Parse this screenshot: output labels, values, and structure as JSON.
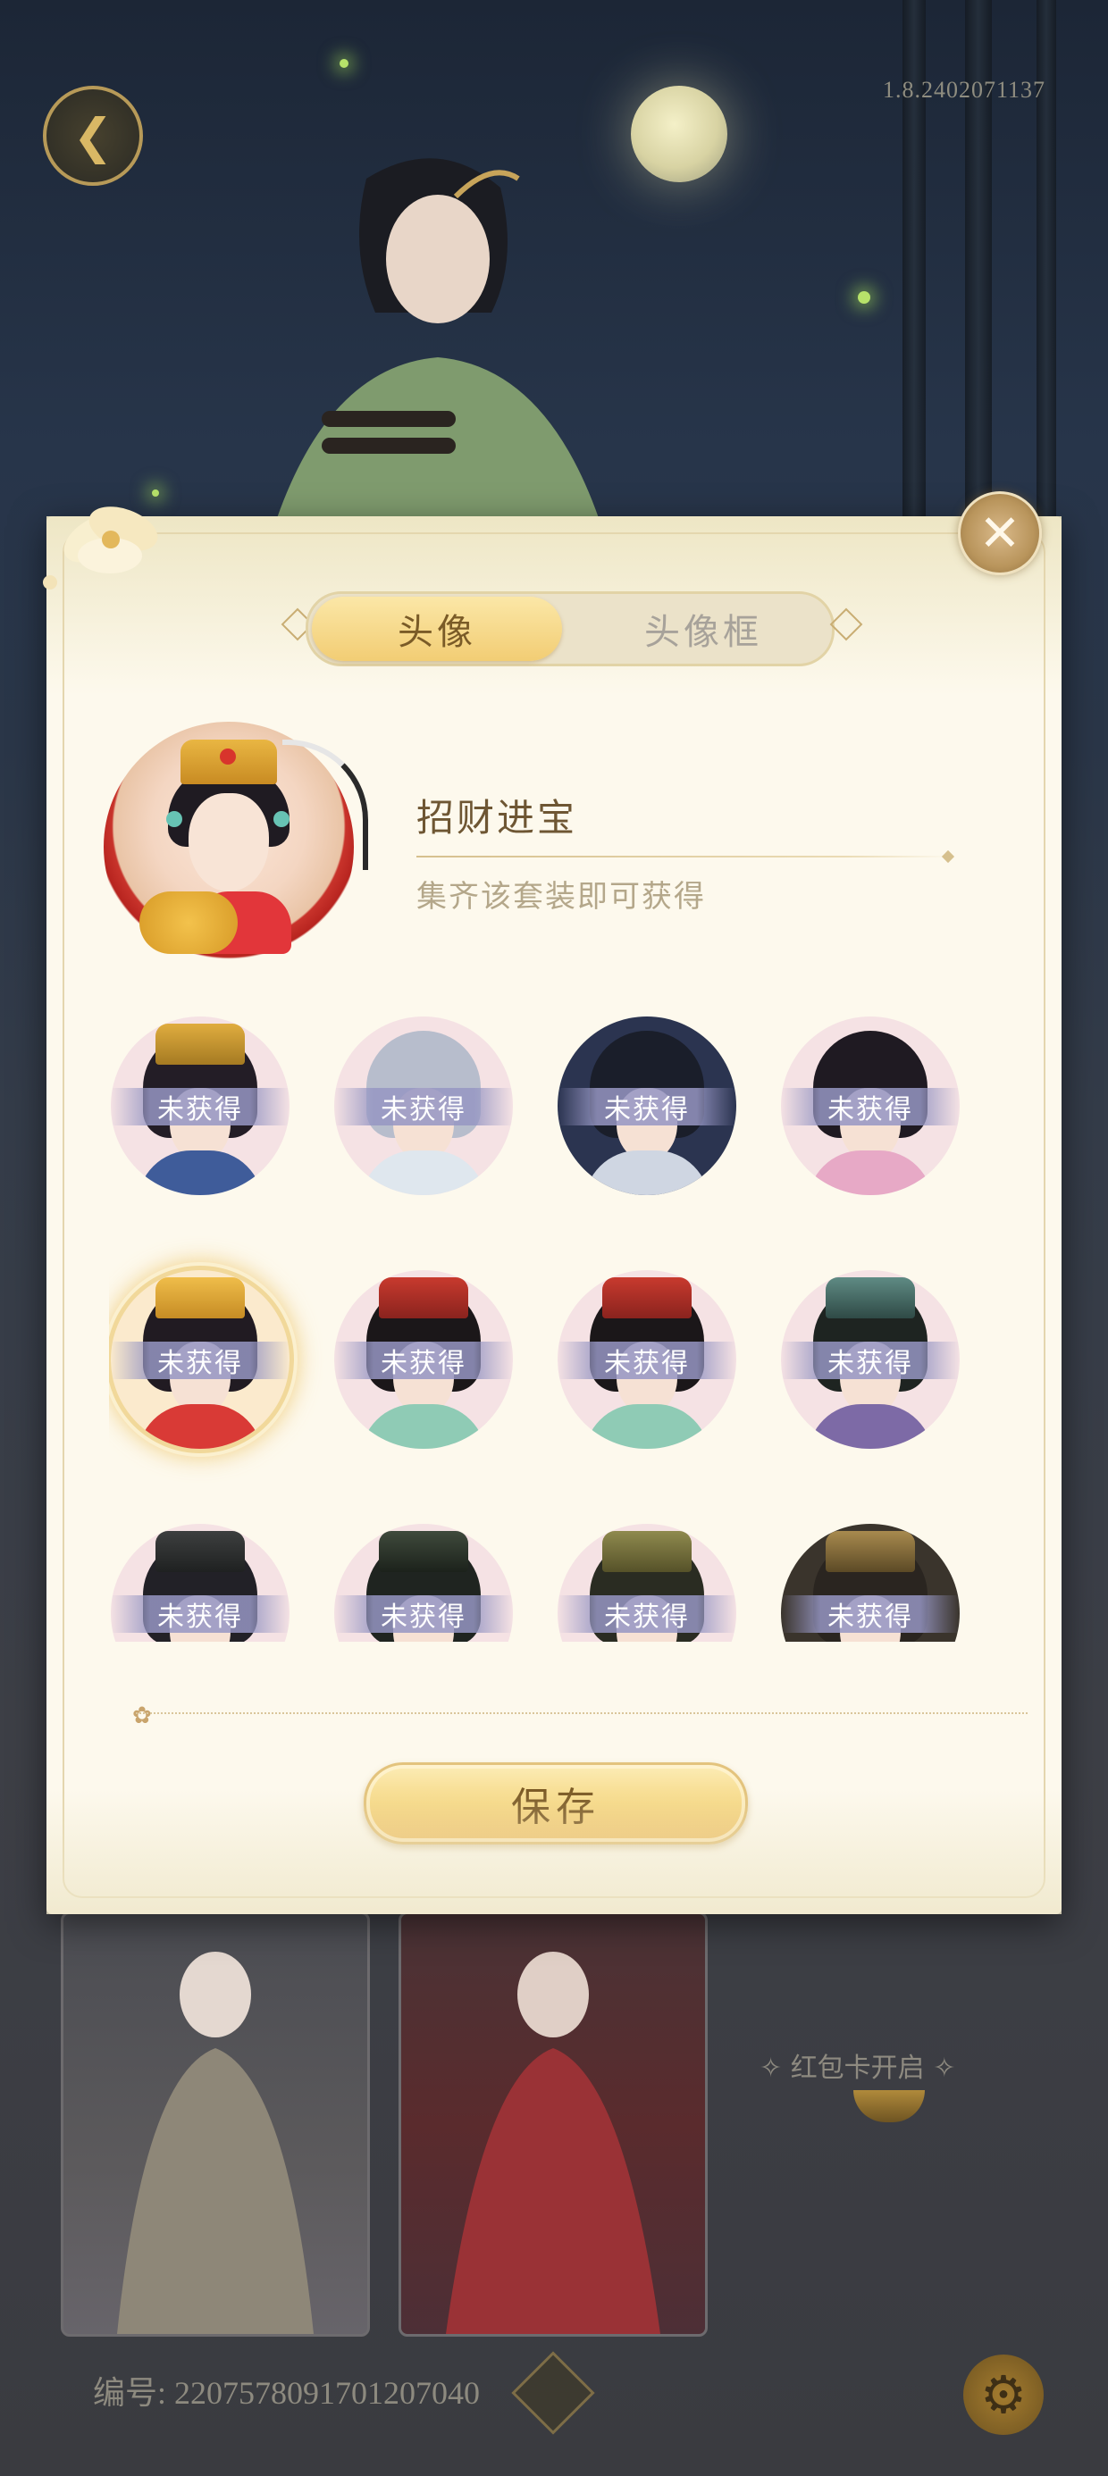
{
  "version_text": "1.8.2402071137",
  "modal": {
    "tabs": [
      {
        "label": "头像",
        "active": true
      },
      {
        "label": "头像框",
        "active": false
      }
    ],
    "selected_item": {
      "name": "招财进宝",
      "description": "集齐该套装即可获得"
    },
    "locked_text": "未获得",
    "avatars": [
      {
        "locked": true,
        "selected": false
      },
      {
        "locked": true,
        "selected": false
      },
      {
        "locked": true,
        "selected": false
      },
      {
        "locked": true,
        "selected": false
      },
      {
        "locked": true,
        "selected": true
      },
      {
        "locked": true,
        "selected": false
      },
      {
        "locked": true,
        "selected": false
      },
      {
        "locked": true,
        "selected": false
      },
      {
        "locked": true,
        "selected": false
      },
      {
        "locked": true,
        "selected": false
      },
      {
        "locked": true,
        "selected": false
      },
      {
        "locked": true,
        "selected": false
      }
    ],
    "save_label": "保存"
  },
  "background": {
    "hongbao_text": "红包卡开启",
    "id_label": "编号:",
    "id_value": "2207578091701207040"
  },
  "icons": {
    "back": "back-arrow-icon",
    "close": "close-x-icon",
    "copy": "copy-icon",
    "settings": "gear-icon"
  },
  "colors": {
    "accent_gold": "#f2cd74",
    "modal_bg": "#fdf9ed",
    "locked_band": "#9696c3",
    "title_brown": "#6e5633"
  }
}
